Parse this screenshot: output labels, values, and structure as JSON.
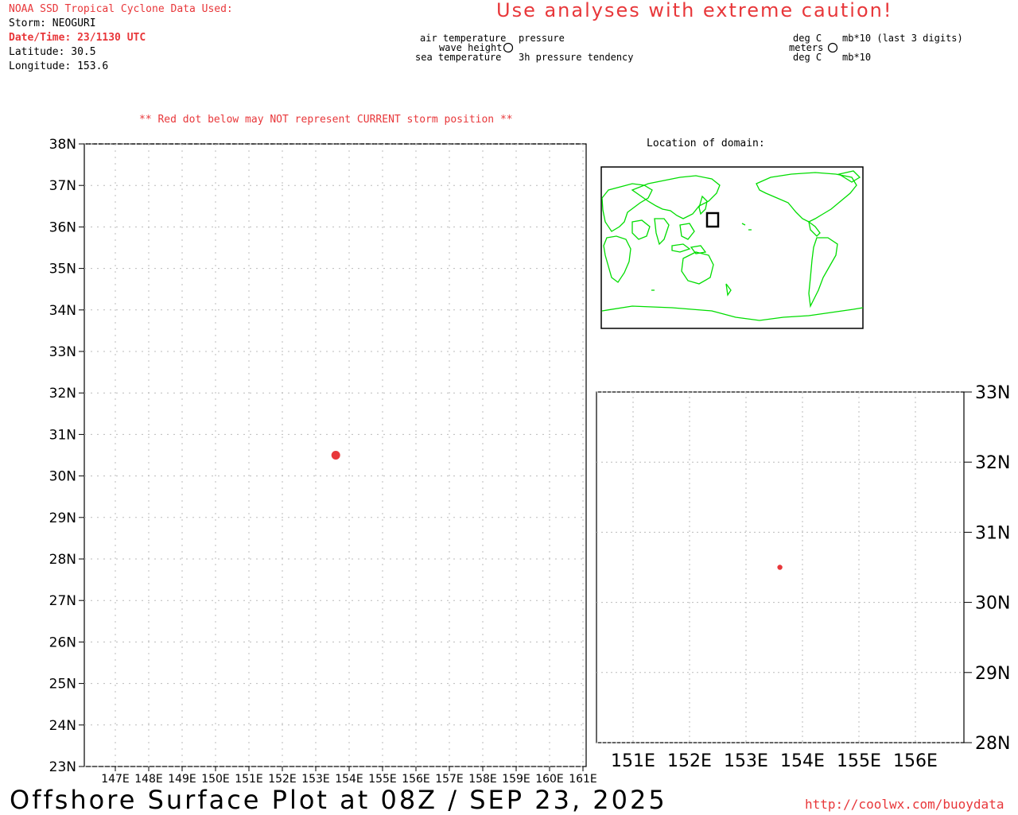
{
  "header": {
    "source_label": "NOAA SSD Tropical Cyclone Data Used:",
    "storm_line": "Storm: NEOGURI",
    "datetime_line": "Date/Time: 23/1130 UTC",
    "latitude_line": "Latitude: 30.5",
    "longitude_line": "Longitude: 153.6"
  },
  "caution": "Use analyses with extreme caution!",
  "station_legend": {
    "left": {
      "top": "air temperature",
      "middle": "wave height",
      "bottom": "sea temperature"
    },
    "right": {
      "top": "pressure",
      "bottom": "3h pressure tendency"
    }
  },
  "units_legend": {
    "left": {
      "top": "deg C",
      "middle": "meters",
      "bottom": "deg C"
    },
    "right": {
      "top": "mb*10 (last 3 digits)",
      "bottom": "mb*10"
    }
  },
  "red_dot_note": "** Red dot below may NOT represent CURRENT storm position **",
  "inset_title": "Location of domain:",
  "footer": {
    "title": "Offshore Surface Plot at 08Z / SEP 23, 2025",
    "url": "http://coolwx.com/buoydata"
  },
  "colors": {
    "storm_dot": "#e8373a",
    "coastline": "#00dd00",
    "text_red": "#e8373a"
  },
  "main_map": {
    "lat_labels": [
      "23N",
      "24N",
      "25N",
      "26N",
      "27N",
      "28N",
      "29N",
      "30N",
      "31N",
      "32N",
      "33N",
      "34N",
      "35N",
      "36N",
      "37N",
      "38N"
    ],
    "lon_labels": [
      "147E",
      "148E",
      "149E",
      "150E",
      "151E",
      "152E",
      "153E",
      "154E",
      "155E",
      "156E",
      "157E",
      "158E",
      "159E",
      "160E",
      "161E"
    ],
    "storm": {
      "lat": 30.5,
      "lon": 153.6
    }
  },
  "zoom_map": {
    "lat_labels": [
      "28N",
      "29N",
      "30N",
      "31N",
      "32N",
      "33N"
    ],
    "lon_labels": [
      "151E",
      "152E",
      "153E",
      "154E",
      "155E",
      "156E"
    ],
    "storm": {
      "lat": 30.5,
      "lon": 153.6
    }
  }
}
